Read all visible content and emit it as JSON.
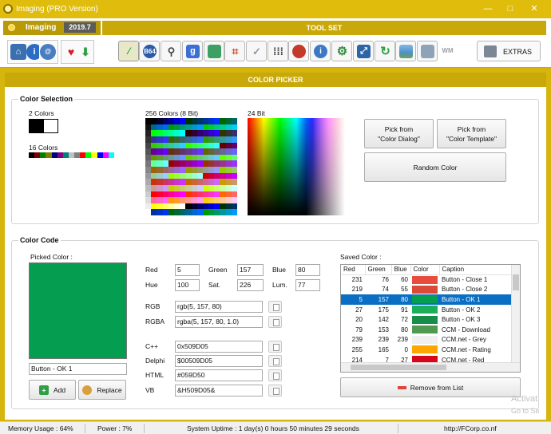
{
  "window": {
    "title": "Imaging (PRO Version)",
    "min": "—",
    "max": "□",
    "close": "✕"
  },
  "logo": {
    "name": "Imaging",
    "version": "2019.7"
  },
  "toolset": {
    "title": "TOOL SET",
    "extras_label": "EXTRAS"
  },
  "tool_icons": [
    "picker",
    "b64",
    "search",
    "google",
    "layers",
    "crop",
    "check",
    "grid",
    "fire",
    "info",
    "gear",
    "resize",
    "refresh",
    "image",
    "batch",
    "wm"
  ],
  "tool_labels": {
    "b64": "B64",
    "google": "g",
    "wm": "WM"
  },
  "colorpicker": {
    "header": "COLOR PICKER"
  },
  "selection": {
    "title": "Color Selection",
    "two_colors_label": "2 Colors",
    "sixteen_colors_label": "16 Colors",
    "sixteen": [
      "#000000",
      "#800000",
      "#008000",
      "#808000",
      "#000080",
      "#800080",
      "#008080",
      "#c0c0c0",
      "#808080",
      "#ff0000",
      "#00ff00",
      "#ffff00",
      "#0000ff",
      "#ff00ff",
      "#00ffff",
      "#ffffff"
    ],
    "c256_label": "256 Colors (8 Bit)",
    "c24_label": "24 Bit",
    "pick_dialog": [
      "Pick from",
      "\"Color Dialog\""
    ],
    "pick_template": [
      "Pick from",
      "\"Color Template\""
    ],
    "random": "Random Color"
  },
  "code": {
    "title": "Color Code",
    "picked_label": "Picked Color :",
    "picked_color": "#059D50",
    "picked_caption": "Button - OK 1",
    "add": "Add",
    "replace": "Replace",
    "red_label": "Red",
    "red": "5",
    "green_label": "Green",
    "green": "157",
    "blue_label": "Blue",
    "blue": "80",
    "hue_label": "Hue",
    "hue": "100",
    "sat_label": "Sat.",
    "sat": "226",
    "lum_label": "Lum.",
    "lum": "77",
    "rgb_label": "RGB",
    "rgb": "rgb(5, 157, 80)",
    "rgba_label": "RGBA",
    "rgba": "rgba(5, 157, 80, 1.0)",
    "cpp_label": "C++",
    "cpp": "0x509D05",
    "delphi_label": "Delphi",
    "delphi": "$00509D05",
    "html_label": "HTML",
    "html": "#059D50",
    "vb_label": "VB",
    "vb": "&H509D05&"
  },
  "saved": {
    "label": "Saved Color :",
    "headers": [
      "Red",
      "Green",
      "Blue",
      "Color",
      "Caption"
    ],
    "rows": [
      {
        "r": "231",
        "g": "76",
        "b": "60",
        "color": "#e74c3c",
        "caption": "Button - Close 1"
      },
      {
        "r": "219",
        "g": "74",
        "b": "55",
        "color": "#db4a37",
        "caption": "Button - Close 2"
      },
      {
        "r": "5",
        "g": "157",
        "b": "80",
        "color": "#059d50",
        "caption": "Button - OK 1"
      },
      {
        "r": "27",
        "g": "175",
        "b": "91",
        "color": "#1baf5b",
        "caption": "Button - OK 2"
      },
      {
        "r": "20",
        "g": "142",
        "b": "72",
        "color": "#148e48",
        "caption": "Button - OK 3"
      },
      {
        "r": "79",
        "g": "153",
        "b": "80",
        "color": "#4f9950",
        "caption": "CCM - Download"
      },
      {
        "r": "239",
        "g": "239",
        "b": "239",
        "color": "#efefef",
        "caption": "CCM.net - Grey"
      },
      {
        "r": "255",
        "g": "165",
        "b": "0",
        "color": "#ffa500",
        "caption": "CCM.net - Rating"
      },
      {
        "r": "214",
        "g": "7",
        "b": "27",
        "color": "#d6071b",
        "caption": "CCM.net - Red"
      }
    ],
    "remove": "Remove from List"
  },
  "status": {
    "memory": "Memory Usage : 64%",
    "power": "Power : 7%",
    "uptime": "System Uptime : 1 day(s) 0 hours 50 minutes 29 seconds",
    "url": "http://FCorp.co.nf"
  },
  "watermark": {
    "line1": "Activat",
    "line2": "Go to Se"
  }
}
